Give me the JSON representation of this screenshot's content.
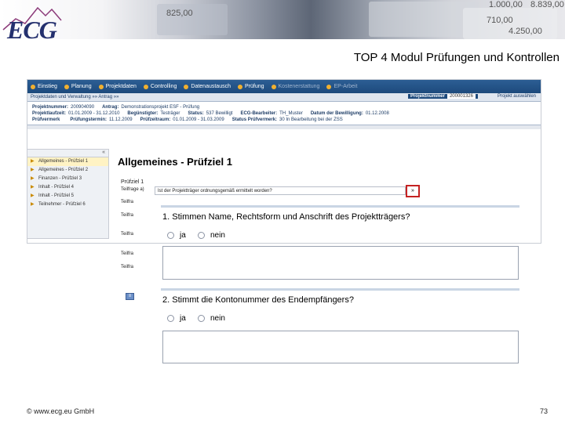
{
  "header": {
    "logo": "ECG",
    "prices": [
      "825,00",
      "1.000,00",
      "8.839,00",
      "710,00",
      "4.250,00"
    ]
  },
  "slide": {
    "title": "TOP 4 Modul Prüfungen und Kontrollen"
  },
  "app": {
    "nav": [
      {
        "label": "Einstieg",
        "dim": false
      },
      {
        "label": "Planung",
        "dim": false
      },
      {
        "label": "Projektdaten",
        "dim": false
      },
      {
        "label": "Controlling",
        "dim": false
      },
      {
        "label": "Datenaustausch",
        "dim": false
      },
      {
        "label": "Prüfung",
        "dim": false
      },
      {
        "label": "Kostenerstattung",
        "dim": true
      },
      {
        "label": "EP-Arbeit",
        "dim": true
      }
    ],
    "subnav": {
      "path": "Projektdaten und Verwaltung »» Antrag »»",
      "project_number_label": "Projektnummer",
      "project_number_value": "200001326",
      "right_link": "Projekt auswählen"
    },
    "info": {
      "row1": [
        {
          "label": "Projektnummer:",
          "value": "200904090"
        },
        {
          "label": "Antrag:",
          "value": "Demonstrationsprojekt ESF - Prüfung"
        }
      ],
      "row2": [
        {
          "label": "Projektlaufzeit:",
          "value": "01.01.2009 - 31.12.2010"
        },
        {
          "label": "Begünstigter:",
          "value": "Testräger"
        },
        {
          "label": "Status:",
          "value": "537 Bewilligt"
        },
        {
          "label": "ECG-Bearbeiter:",
          "value": "TH_Muster"
        },
        {
          "label": "Datum der Bewilligung:",
          "value": "01.12.2008"
        }
      ],
      "row3": [
        {
          "label": "Prüfvermerk",
          "value": ""
        },
        {
          "label": "Prüfungstermin:",
          "value": "11.12.2009"
        },
        {
          "label": "Prüfzeitraum:",
          "value": "01.01.2009 - 31.03.2009"
        },
        {
          "label": "Status Prüfvermerk:",
          "value": "30 In Bearbeitung bei der ZSS"
        }
      ]
    },
    "sidebar": {
      "collapse": "«",
      "items": [
        {
          "label": "Allgemeines - Prüfziel 1",
          "active": true
        },
        {
          "label": "Allgemeines - Prüfziel 2",
          "active": false
        },
        {
          "label": "Finanzen - Prüfziel 3",
          "active": false
        },
        {
          "label": "Inhalt - Prüfziel 4",
          "active": false
        },
        {
          "label": "Inhalt - Prüfziel 5",
          "active": false
        },
        {
          "label": "Teilnehmer - Prüfziel 6",
          "active": false
        }
      ]
    },
    "content": {
      "title": "Allgemeines - Prüfziel 1",
      "pruefziel_label": "Prüfziel 1",
      "teilfrage_label": "Teilfrage a)",
      "teilfrage_text": "Ist der Projektträger ordnungsgemäß ermittelt worden?",
      "teilfrage_btn": "»",
      "side_labels": [
        "Teilfra",
        "Teilfra",
        "Teilfra",
        "Teilfra",
        "Teilfra"
      ],
      "questions": [
        {
          "text": "1. Stimmen Name, Rechtsform und Anschrift des Projektträgers?",
          "yes": "ja",
          "no": "nein"
        },
        {
          "text": "2. Stimmt die Kontonummer des Endempfängers?",
          "yes": "ja",
          "no": "nein"
        }
      ]
    }
  },
  "footer": {
    "copyright": "© www.ecg.eu GmbH",
    "page": "73"
  }
}
